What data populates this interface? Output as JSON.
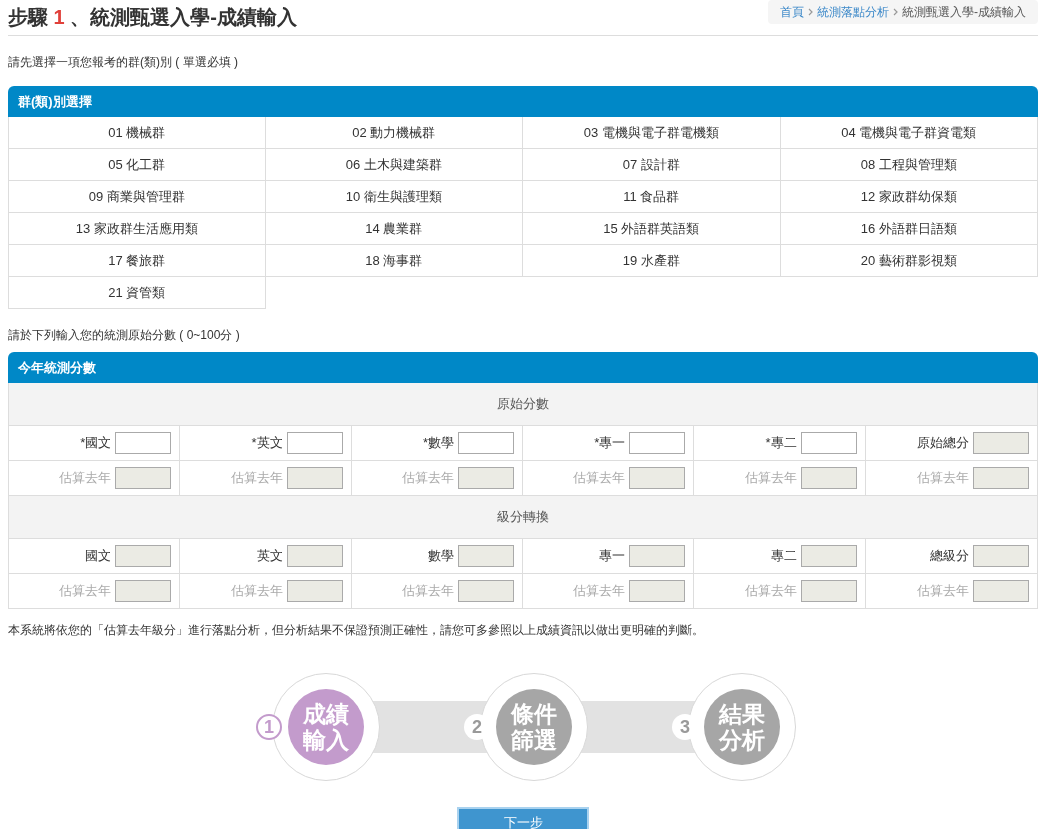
{
  "page_title": {
    "prefix": "步驟",
    "step": "1",
    "suffix": "、統測甄選入學-成績輸入"
  },
  "breadcrumb": [
    {
      "label": "首頁",
      "link": true
    },
    {
      "label": "統測落點分析",
      "link": true
    },
    {
      "label": "統測甄選入學-成績輸入",
      "link": false
    }
  ],
  "group_instruction": "請先選擇一項您報考的群(類)別 ( 單選必填 )",
  "group_panel": {
    "title": "群(類)別選擇",
    "items": [
      {
        "label": "01 機械群",
        "selected": false
      },
      {
        "label": "02 動力機械群",
        "selected": false
      },
      {
        "label": "03 電機與電子群電機類",
        "selected": false
      },
      {
        "label": "04 電機與電子群資電類",
        "selected": false
      },
      {
        "label": "05 化工群",
        "selected": false
      },
      {
        "label": "06 土木與建築群",
        "selected": false
      },
      {
        "label": "07 設計群",
        "selected": false
      },
      {
        "label": "08 工程與管理類",
        "selected": false
      },
      {
        "label": "09 商業與管理群",
        "selected": false
      },
      {
        "label": "10 衛生與護理類",
        "selected": false
      },
      {
        "label": "11 食品群",
        "selected": false
      },
      {
        "label": "12 家政群幼保類",
        "selected": false
      },
      {
        "label": "13 家政群生活應用類",
        "selected": false
      },
      {
        "label": "14 農業群",
        "selected": false
      },
      {
        "label": "15 外語群英語類",
        "selected": false
      },
      {
        "label": "16 外語群日語類",
        "selected": false
      },
      {
        "label": "17 餐旅群",
        "selected": false
      },
      {
        "label": "18 海事群",
        "selected": false
      },
      {
        "label": "19 水產群",
        "selected": false
      },
      {
        "label": "20 藝術群影視類",
        "selected": false
      },
      {
        "label": "21 資管類",
        "selected": false
      }
    ]
  },
  "score_instruction": "請於下列輸入您的統測原始分數 ( 0~100分 )",
  "score_panel": {
    "title": "今年統測分數",
    "sections": [
      {
        "heading": "原始分數",
        "rows": [
          {
            "muted": false,
            "cells": [
              {
                "label": "*國文",
                "disabled": false
              },
              {
                "label": "*英文",
                "disabled": false
              },
              {
                "label": "*數學",
                "disabled": false
              },
              {
                "label": "*專一",
                "disabled": false
              },
              {
                "label": "*專二",
                "disabled": false
              },
              {
                "label": "原始總分",
                "disabled": true
              }
            ]
          },
          {
            "muted": true,
            "cells": [
              {
                "label": "估算去年",
                "disabled": true
              },
              {
                "label": "估算去年",
                "disabled": true
              },
              {
                "label": "估算去年",
                "disabled": true
              },
              {
                "label": "估算去年",
                "disabled": true
              },
              {
                "label": "估算去年",
                "disabled": true
              },
              {
                "label": "估算去年",
                "disabled": true
              }
            ]
          }
        ]
      },
      {
        "heading": "級分轉換",
        "rows": [
          {
            "muted": false,
            "cells": [
              {
                "label": "國文",
                "disabled": true
              },
              {
                "label": "英文",
                "disabled": true
              },
              {
                "label": "數學",
                "disabled": true
              },
              {
                "label": "專一",
                "disabled": true
              },
              {
                "label": "專二",
                "disabled": true
              },
              {
                "label": "總級分",
                "disabled": true
              }
            ]
          },
          {
            "muted": true,
            "cells": [
              {
                "label": "估算去年",
                "disabled": true
              },
              {
                "label": "估算去年",
                "disabled": true
              },
              {
                "label": "估算去年",
                "disabled": true
              },
              {
                "label": "估算去年",
                "disabled": true
              },
              {
                "label": "估算去年",
                "disabled": true
              },
              {
                "label": "估算去年",
                "disabled": true
              }
            ]
          }
        ]
      }
    ]
  },
  "notice": "本系統將依您的「估算去年級分」進行落點分析，但分析結果不保證預測正確性，請您可多參照以上成績資訊以做出更明確的判斷。",
  "steps": [
    {
      "number": "1",
      "lines": [
        "成績",
        "輸入"
      ],
      "selected": true
    },
    {
      "number": "2",
      "lines": [
        "條件",
        "篩選"
      ],
      "selected": false
    },
    {
      "number": "3",
      "lines": [
        "結果",
        "分析"
      ],
      "selected": false
    }
  ],
  "next_button": "下一步"
}
